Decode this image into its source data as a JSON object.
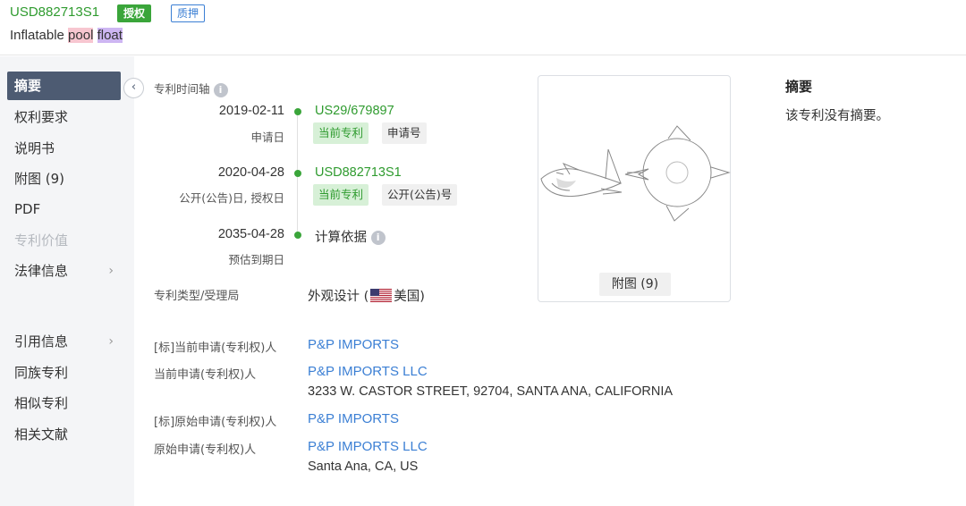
{
  "header": {
    "patent_number": "USD882713S1",
    "badge_granted": "授权",
    "badge_pledge": "质押",
    "title_prefix": "Inflatable ",
    "title_hl1": "pool",
    "title_space": " ",
    "title_hl2": "float"
  },
  "sidebar": {
    "items": [
      {
        "label": "摘要",
        "active": true
      },
      {
        "label": "权利要求"
      },
      {
        "label": "说明书"
      },
      {
        "label": "附图 (9)"
      },
      {
        "label": "PDF"
      },
      {
        "label": "专利价值",
        "disabled": true
      },
      {
        "label": "法律信息",
        "has_arrow": true
      },
      {
        "label": "引用信息",
        "has_arrow": true
      },
      {
        "label": "同族专利"
      },
      {
        "label": "相似专利"
      },
      {
        "label": "相关文献"
      }
    ],
    "chevron": "›",
    "collapse_icon": "‹"
  },
  "timeline": {
    "label": "专利时间轴",
    "info_icon": "i",
    "events": [
      {
        "date": "2019-02-11",
        "sub": "申请日",
        "link": "US29/679897",
        "chips": [
          "当前专利",
          "申请号"
        ]
      },
      {
        "date": "2020-04-28",
        "sub": "公开(公告)日, 授权日",
        "link": "USD882713S1",
        "chips": [
          "当前专利",
          "公开(公告)号"
        ]
      },
      {
        "date": "2035-04-28",
        "sub": "预估到期日",
        "text": "计算依据"
      }
    ]
  },
  "fields": {
    "type_label": "专利类型/受理局",
    "type_value_prefix": "外观设计 (",
    "type_value_country": "美国)",
    "std_current_label": "[标]当前申请(专利权)人",
    "std_current_value": "P&P IMPORTS",
    "current_label": "当前申请(专利权)人",
    "current_value": "P&P IMPORTS LLC",
    "current_address": "3233 W. CASTOR STREET, 92704, SANTA ANA, CALIFORNIA",
    "std_original_label": "[标]原始申请(专利权)人",
    "std_original_value": "P&P IMPORTS",
    "original_label": "原始申请(专利权)人",
    "original_value": "P&P IMPORTS LLC",
    "original_address": "Santa Ana, CA, US"
  },
  "figure": {
    "button_label": "附图 (9)"
  },
  "abstract": {
    "title": "摘要",
    "text": "该专利没有摘要。"
  },
  "colors": {
    "accent_green": "#3aa53a",
    "link_blue": "#3b7fd4",
    "sidebar_active": "#4d5b72"
  }
}
